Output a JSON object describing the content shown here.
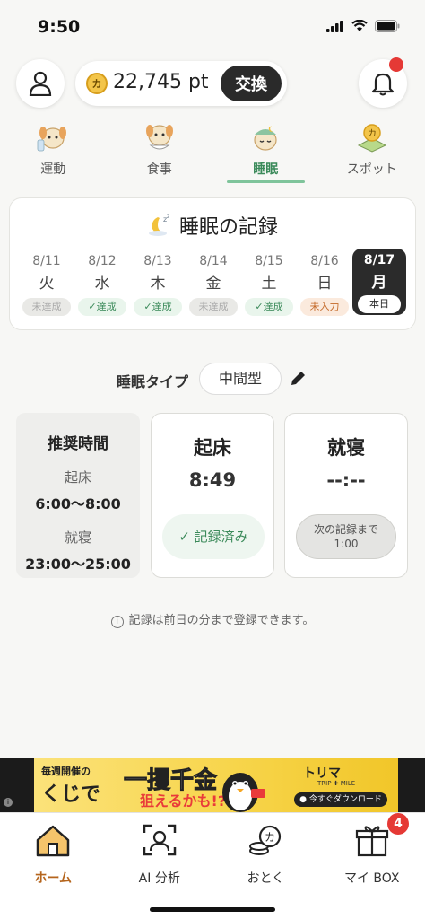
{
  "status_bar": {
    "time": "9:50"
  },
  "header": {
    "points": "22,745 pt",
    "coin_symbol": "カ",
    "exchange_label": "交換"
  },
  "tabs": [
    {
      "label": "運動",
      "icon": "dog-exercise-icon",
      "active": false
    },
    {
      "label": "食事",
      "icon": "dog-meal-icon",
      "active": false
    },
    {
      "label": "睡眠",
      "icon": "dog-sleep-icon",
      "active": true
    },
    {
      "label": "スポット",
      "icon": "spot-coin-icon",
      "active": false
    }
  ],
  "sleep_record": {
    "title": "睡眠の記録",
    "days": [
      {
        "date": "8/11",
        "dow": "火",
        "status": "未達成",
        "kind": "gray"
      },
      {
        "date": "8/12",
        "dow": "水",
        "status": "✓達成",
        "kind": "green"
      },
      {
        "date": "8/13",
        "dow": "木",
        "status": "✓達成",
        "kind": "green"
      },
      {
        "date": "8/14",
        "dow": "金",
        "status": "未達成",
        "kind": "gray"
      },
      {
        "date": "8/15",
        "dow": "土",
        "status": "✓達成",
        "kind": "green"
      },
      {
        "date": "8/16",
        "dow": "日",
        "status": "未入力",
        "kind": "orange"
      },
      {
        "date": "8/17",
        "dow": "月",
        "status": "本日",
        "kind": "today"
      }
    ]
  },
  "sleep_type": {
    "label": "睡眠タイプ",
    "value": "中間型"
  },
  "recommended": {
    "title": "推奨時間",
    "wake_label": "起床",
    "wake_value": "6:00〜8:00",
    "bed_label": "就寝",
    "bed_value": "23:00〜25:00"
  },
  "wake_card": {
    "title": "起床",
    "time": "8:49",
    "button": "✓ 記録済み"
  },
  "bed_card": {
    "title": "就寝",
    "time": "--:--",
    "button_line1": "次の記録まで",
    "button_line2": "1:00"
  },
  "note": "記録は前日の分まで登録できます。",
  "ad": {
    "line1": "毎週開催の",
    "line2": "くじで",
    "line3": "一攫千金",
    "line4": "狙えるかも!?",
    "brand": "トリマ",
    "brand_sub": "TRIP ✚ MILE",
    "download": "● 今すぐダウンロード",
    "info_mark": "i"
  },
  "bottom_nav": [
    {
      "label": "ホーム",
      "icon": "home-icon",
      "active": true
    },
    {
      "label": "AI 分析",
      "icon": "ai-scan-icon",
      "active": false
    },
    {
      "label": "おとく",
      "icon": "coins-icon",
      "active": false
    },
    {
      "label": "マイ BOX",
      "icon": "gift-box-icon",
      "active": false,
      "badge": "4"
    }
  ],
  "colors": {
    "accent_green": "#3b8a5a",
    "active_home": "#b5651d",
    "alert_red": "#e53935",
    "dark": "#2b2b2b"
  }
}
